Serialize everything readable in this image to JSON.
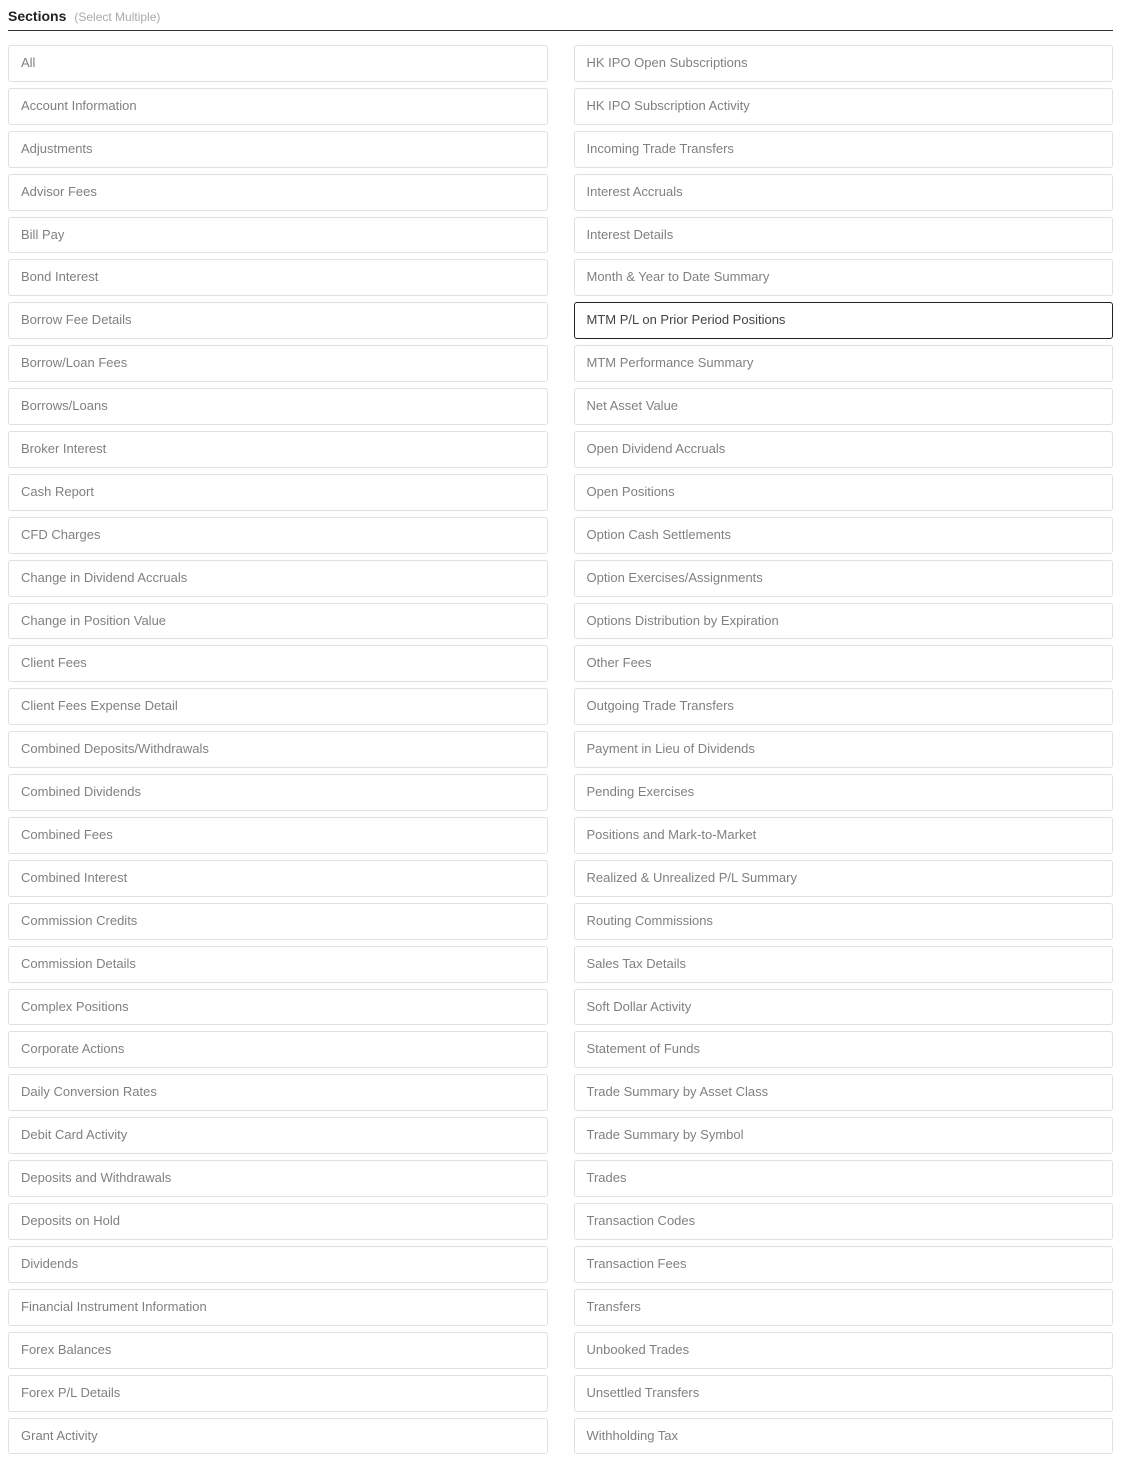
{
  "header": {
    "title": "Sections",
    "hint": "(Select Multiple)"
  },
  "columns": {
    "left": [
      "All",
      "Account Information",
      "Adjustments",
      "Advisor Fees",
      "Bill Pay",
      "Bond Interest",
      "Borrow Fee Details",
      "Borrow/Loan Fees",
      "Borrows/Loans",
      "Broker Interest",
      "Cash Report",
      "CFD Charges",
      "Change in Dividend Accruals",
      "Change in Position Value",
      "Client Fees",
      "Client Fees Expense Detail",
      "Combined Deposits/Withdrawals",
      "Combined Dividends",
      "Combined Fees",
      "Combined Interest",
      "Commission Credits",
      "Commission Details",
      "Complex Positions",
      "Corporate Actions",
      "Daily Conversion Rates",
      "Debit Card Activity",
      "Deposits and Withdrawals",
      "Deposits on Hold",
      "Dividends",
      "Financial Instrument Information",
      "Forex Balances",
      "Forex P/L Details",
      "Grant Activity"
    ],
    "right": [
      "HK IPO Open Subscriptions",
      "HK IPO Subscription Activity",
      "Incoming Trade Transfers",
      "Interest Accruals",
      "Interest Details",
      "Month & Year to Date Summary",
      "MTM P/L on Prior Period Positions",
      "MTM Performance Summary",
      "Net Asset Value",
      "Open Dividend Accruals",
      "Open Positions",
      "Option Cash Settlements",
      "Option Exercises/Assignments",
      "Options Distribution by Expiration",
      "Other Fees",
      "Outgoing Trade Transfers",
      "Payment in Lieu of Dividends",
      "Pending Exercises",
      "Positions and Mark-to-Market",
      "Realized & Unrealized P/L Summary",
      "Routing Commissions",
      "Sales Tax Details",
      "Soft Dollar Activity",
      "Statement of Funds",
      "Trade Summary by Asset Class",
      "Trade Summary by Symbol",
      "Trades",
      "Transaction Codes",
      "Transaction Fees",
      "Transfers",
      "Unbooked Trades",
      "Unsettled Transfers",
      "Withholding Tax"
    ]
  },
  "selected": "MTM P/L on Prior Period Positions"
}
